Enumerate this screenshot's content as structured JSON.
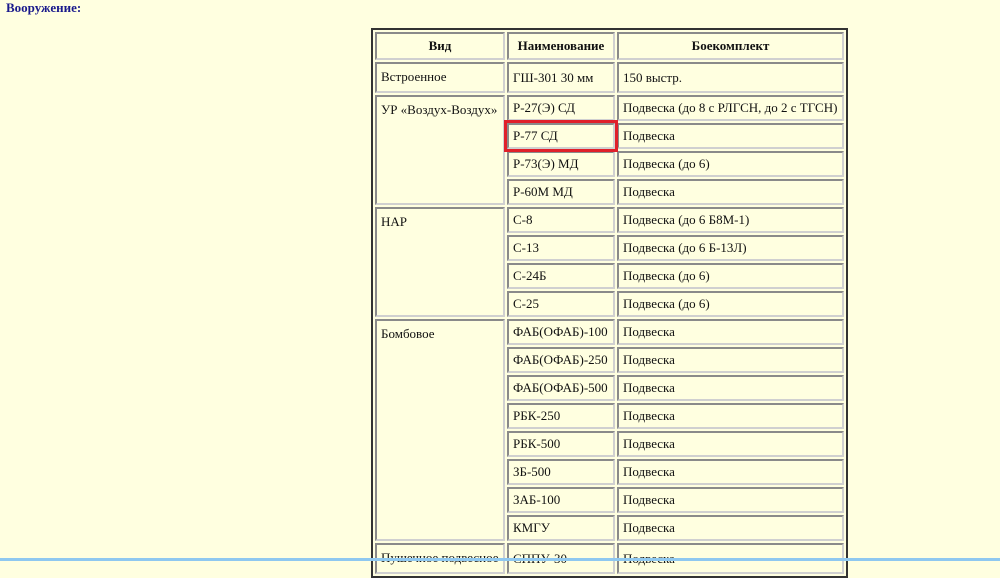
{
  "title": "Вооружение:",
  "headers": [
    "Вид",
    "Наименование",
    "Боекомплект"
  ],
  "groups": [
    {
      "kind": "Встроенное",
      "items": [
        {
          "name": "ГШ-301 30 мм",
          "ammo": "150 выстр."
        }
      ]
    },
    {
      "kind": "УР «Воздух-Воздух»",
      "items": [
        {
          "name": "Р-27(Э) СД",
          "ammo": "Подвеска (до 8 с РЛГСН, до 2 с ТГСН)"
        },
        {
          "name": "Р-77 СД",
          "ammo": "Подвеска",
          "highlighted": true
        },
        {
          "name": "Р-73(Э) МД",
          "ammo": "Подвеска (до 6)"
        },
        {
          "name": "Р-60М МД",
          "ammo": "Подвеска"
        }
      ]
    },
    {
      "kind": "НАР",
      "items": [
        {
          "name": "С-8",
          "ammo": "Подвеска (до 6 Б8М-1)"
        },
        {
          "name": "С-13",
          "ammo": "Подвеска (до 6 Б-13Л)"
        },
        {
          "name": "С-24Б",
          "ammo": "Подвеска (до 6)"
        },
        {
          "name": "С-25",
          "ammo": "Подвеска (до 6)"
        }
      ]
    },
    {
      "kind": "Бомбовое",
      "items": [
        {
          "name": "ФАБ(ОФАБ)-100",
          "ammo": "Подвеска"
        },
        {
          "name": "ФАБ(ОФАБ)-250",
          "ammo": "Подвеска"
        },
        {
          "name": "ФАБ(ОФАБ)-500",
          "ammo": "Подвеска"
        },
        {
          "name": "РБК-250",
          "ammo": "Подвеска"
        },
        {
          "name": "РБК-500",
          "ammo": "Подвеска"
        },
        {
          "name": "ЗБ-500",
          "ammo": "Подвеска"
        },
        {
          "name": "ЗАБ-100",
          "ammo": "Подвеска"
        },
        {
          "name": "КМГУ",
          "ammo": "Подвеска"
        }
      ]
    },
    {
      "kind": "Пушечное подвесное",
      "items": [
        {
          "name": "СППУ-30",
          "ammo": "Подвеска"
        }
      ]
    }
  ]
}
